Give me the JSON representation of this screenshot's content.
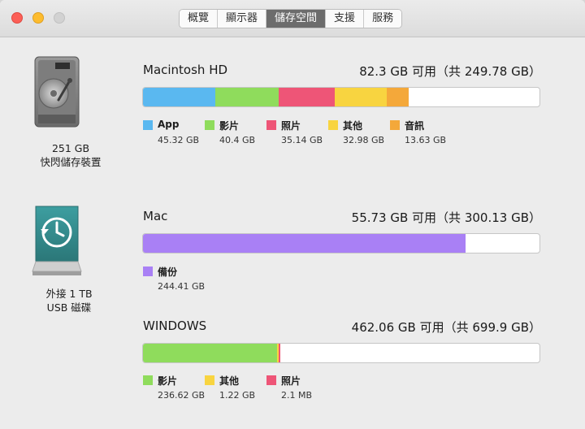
{
  "window": {
    "tabs": [
      {
        "label": "概覽",
        "active": false
      },
      {
        "label": "顯示器",
        "active": false
      },
      {
        "label": "儲存空間",
        "active": true
      },
      {
        "label": "支援",
        "active": false
      },
      {
        "label": "服務",
        "active": false
      }
    ]
  },
  "colors": {
    "app": "#5ab8f0",
    "movies": "#8fdc5c",
    "photos": "#ee5577",
    "other": "#f8d440",
    "music": "#f4a83a",
    "backups": "#a980f5"
  },
  "devices": [
    {
      "icon": "internal-drive-icon",
      "size": "251 GB",
      "type": "快閃儲存裝置"
    },
    {
      "icon": "time-machine-drive-icon",
      "size": "外接 1 TB",
      "type": "USB 磁碟"
    }
  ],
  "volumes": [
    {
      "name": "Macintosh HD",
      "free": "82.3 GB 可用（共 249.78 GB）",
      "total": 249.78,
      "segments": [
        {
          "label": "App",
          "size": "45.32 GB",
          "value": 45.32,
          "color": "#5ab8f0"
        },
        {
          "label": "影片",
          "size": "40.4 GB",
          "value": 40.4,
          "color": "#8fdc5c"
        },
        {
          "label": "照片",
          "size": "35.14 GB",
          "value": 35.14,
          "color": "#ee5577"
        },
        {
          "label": "其他",
          "size": "32.98 GB",
          "value": 32.98,
          "color": "#f8d440"
        },
        {
          "label": "音訊",
          "size": "13.63 GB",
          "value": 13.63,
          "color": "#f4a83a"
        }
      ]
    },
    {
      "name": "Mac",
      "free": "55.73 GB 可用（共 300.13 GB）",
      "total": 300.13,
      "segments": [
        {
          "label": "備份",
          "size": "244.41 GB",
          "value": 244.41,
          "color": "#a980f5"
        }
      ]
    },
    {
      "name": "WINDOWS",
      "free": "462.06 GB 可用（共 699.9 GB）",
      "total": 699.9,
      "segments": [
        {
          "label": "影片",
          "size": "236.62 GB",
          "value": 236.62,
          "color": "#8fdc5c"
        },
        {
          "label": "其他",
          "size": "1.22 GB",
          "value": 1.22,
          "color": "#f8d440"
        },
        {
          "label": "照片",
          "size": "2.1 MB",
          "value": 0.0021,
          "color": "#ee5577"
        }
      ]
    }
  ]
}
